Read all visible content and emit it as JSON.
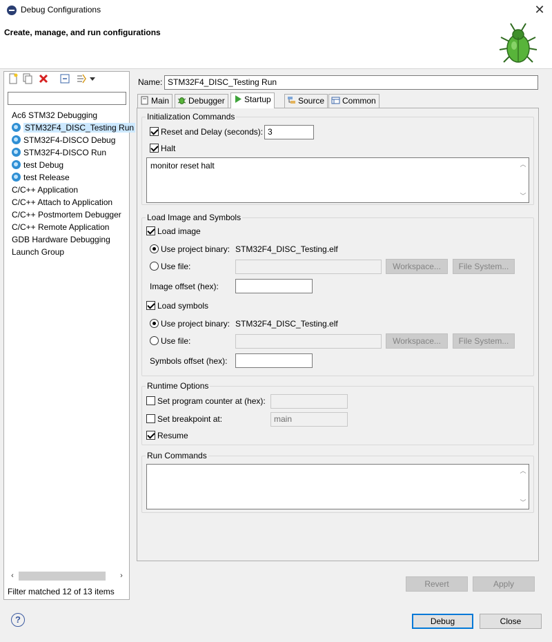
{
  "window": {
    "title": "Debug Configurations",
    "close_glyph": "✕"
  },
  "banner": {
    "title": "Create, manage, and run configurations",
    "icon": "bug-icon"
  },
  "left": {
    "filter_value": "",
    "tree": [
      {
        "label": "Ac6 STM32 Debugging",
        "level": 0,
        "icon": null
      },
      {
        "label": "STM32F4_DISC_Testing Run",
        "level": 1,
        "icon": "config-icon",
        "selected": true
      },
      {
        "label": "STM32F4-DISCO Debug",
        "level": 1,
        "icon": "config-icon"
      },
      {
        "label": "STM32F4-DISCO Run",
        "level": 1,
        "icon": "config-icon"
      },
      {
        "label": "test Debug",
        "level": 1,
        "icon": "config-icon"
      },
      {
        "label": "test Release",
        "level": 1,
        "icon": "config-icon"
      },
      {
        "label": "C/C++ Application",
        "level": 0,
        "icon": null
      },
      {
        "label": "C/C++ Attach to Application",
        "level": 0,
        "icon": null
      },
      {
        "label": "C/C++ Postmortem Debugger",
        "level": 0,
        "icon": null
      },
      {
        "label": "C/C++ Remote Application",
        "level": 0,
        "icon": null
      },
      {
        "label": "GDB Hardware Debugging",
        "level": 0,
        "icon": null
      },
      {
        "label": "Launch Group",
        "level": 0,
        "icon": null
      }
    ],
    "status": "Filter matched 12 of 13 items"
  },
  "name": {
    "label": "Name:",
    "value": "STM32F4_DISC_Testing Run"
  },
  "tabs": [
    {
      "label": "Main",
      "icon": "main-tab-icon"
    },
    {
      "label": "Debugger",
      "icon": "debugger-tab-icon"
    },
    {
      "label": "Startup",
      "icon": "startup-tab-icon",
      "active": true
    },
    {
      "label": "Source",
      "icon": "source-tab-icon"
    },
    {
      "label": "Common",
      "icon": "common-tab-icon"
    }
  ],
  "init": {
    "title": "Initialization Commands",
    "reset_delay_label": "Reset and Delay (seconds):",
    "reset_delay_value": "3",
    "halt_label": "Halt",
    "commands": "monitor reset halt"
  },
  "load": {
    "title": "Load Image and Symbols",
    "load_image_label": "Load image",
    "use_project_binary_label": "Use project binary:",
    "image_binary": "STM32F4_DISC_Testing.elf",
    "use_file_label": "Use file:",
    "workspace_label": "Workspace...",
    "filesystem_label": "File System...",
    "image_offset_label": "Image offset (hex):",
    "load_symbols_label": "Load symbols",
    "symbols_binary": "STM32F4_DISC_Testing.elf",
    "symbols_offset_label": "Symbols offset (hex):"
  },
  "runtime": {
    "title": "Runtime Options",
    "set_pc_label": "Set program counter at (hex):",
    "set_bp_label": "Set breakpoint at:",
    "bp_value": "main",
    "resume_label": "Resume"
  },
  "run_commands": {
    "title": "Run Commands",
    "value": ""
  },
  "buttons": {
    "revert": "Revert",
    "apply": "Apply",
    "debug": "Debug",
    "close": "Close",
    "help": "?"
  }
}
